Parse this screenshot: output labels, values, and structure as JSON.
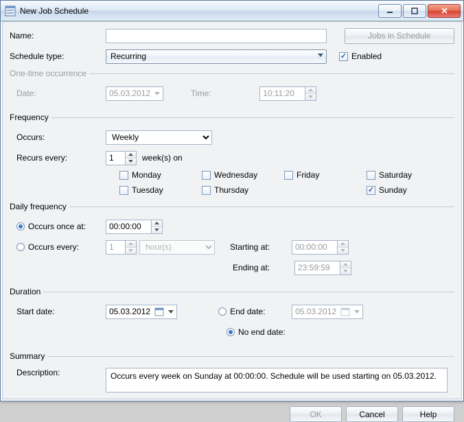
{
  "window": {
    "title": "New Job Schedule"
  },
  "header": {
    "name_label": "Name:",
    "name_value": "",
    "jobs_button": "Jobs in Schedule",
    "type_label": "Schedule type:",
    "type_value": "Recurring",
    "enabled_label": "Enabled",
    "enabled_checked": true
  },
  "one_time": {
    "legend": "One-time occurrence",
    "date_label": "Date:",
    "date_value": "05.03.2012",
    "time_label": "Time:",
    "time_value": "10:11:20"
  },
  "frequency": {
    "legend": "Frequency",
    "occurs_label": "Occurs:",
    "occurs_value": "Weekly",
    "recurs_label": "Recurs every:",
    "recurs_value": "1",
    "recurs_unit": "week(s) on",
    "days": {
      "monday": "Monday",
      "tuesday": "Tuesday",
      "wednesday": "Wednesday",
      "thursday": "Thursday",
      "friday": "Friday",
      "saturday": "Saturday",
      "sunday": "Sunday"
    },
    "days_checked": {
      "sunday": true
    }
  },
  "daily": {
    "legend": "Daily frequency",
    "once_label": "Occurs once at:",
    "once_value": "00:00:00",
    "every_label": "Occurs every:",
    "every_value": "1",
    "every_unit": "hour(s)",
    "starting_label": "Starting at:",
    "starting_value": "00:00:00",
    "ending_label": "Ending at:",
    "ending_value": "23:59:59"
  },
  "duration": {
    "legend": "Duration",
    "start_label": "Start date:",
    "start_value": "05.03.2012",
    "end_label": "End date:",
    "end_value": "05.03.2012",
    "noend_label": "No end date:"
  },
  "summary": {
    "legend": "Summary",
    "desc_label": "Description:",
    "desc_value": "Occurs every week on Sunday at 00:00:00. Schedule will be used starting on 05.03.2012."
  },
  "footer": {
    "ok": "OK",
    "cancel": "Cancel",
    "help": "Help"
  }
}
